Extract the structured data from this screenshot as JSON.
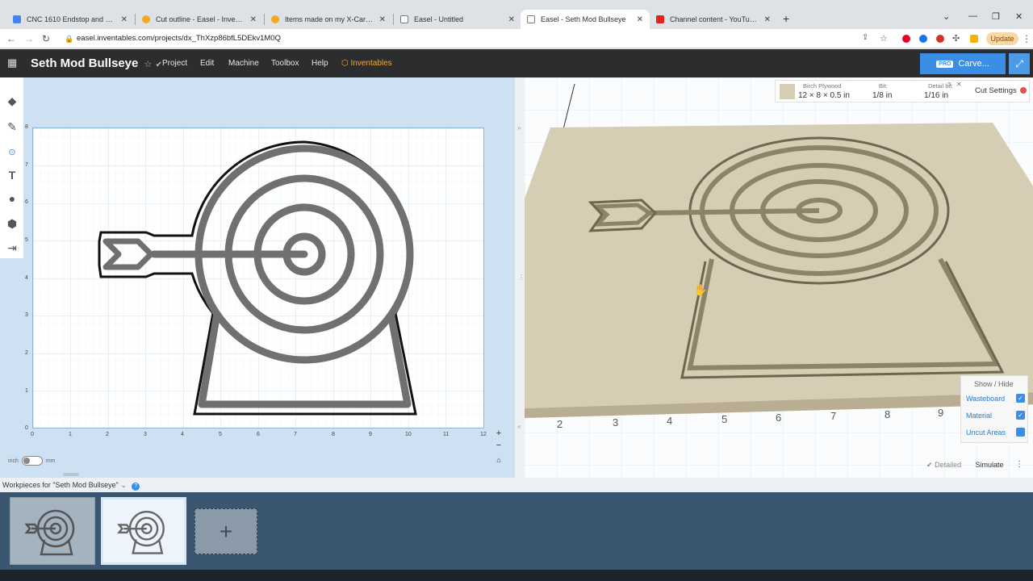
{
  "browser": {
    "tabs": [
      {
        "title": "CNC 1610 Endstop and Chain Fix",
        "favicon_color": "#4285f4"
      },
      {
        "title": "Cut outline - Easel - Inventables",
        "favicon_color": "#f5a623"
      },
      {
        "title": "Items made on my X-Carve Pro -",
        "favicon_color": "#f5a623"
      },
      {
        "title": "Easel - Untitled",
        "favicon_color": "#7a7a7a"
      },
      {
        "title": "Easel - Seth Mod Bullseye",
        "favicon_color": "#7a7a7a"
      },
      {
        "title": "Channel content - YouTube Studio",
        "favicon_color": "#e62117"
      }
    ],
    "active_tab": 4,
    "url": "easel.inventables.com/projects/dx_ThXzp86bfL5DEkv1M0Q",
    "update_label": "Update"
  },
  "app": {
    "project_title": "Seth Mod Bullseye",
    "menu": [
      "Project",
      "Edit",
      "Machine",
      "Toolbox",
      "Help"
    ],
    "inventables_label": "Inventables",
    "carve": {
      "badge": "PRO",
      "label": "Carve..."
    }
  },
  "design": {
    "y_ticks": [
      "8",
      "7",
      "6",
      "5",
      "4",
      "3",
      "2",
      "1",
      "0"
    ],
    "x_ticks": [
      "0",
      "1",
      "2",
      "3",
      "4",
      "5",
      "6",
      "7",
      "8",
      "9",
      "10",
      "11",
      "12"
    ],
    "unit_left": "inch",
    "unit_right": "mm"
  },
  "preview": {
    "material_label": "Birch Plywood",
    "material_value": "12 × 8 × 0.5 in",
    "bit_label": "Bit:",
    "bit_value": "1/8 in",
    "detail_bit_label": "Detail bit:",
    "detail_bit_value": "1/16 in",
    "cut_settings": "Cut Settings",
    "x_ticks": [
      "2",
      "3",
      "4",
      "5",
      "6",
      "7",
      "8",
      "9"
    ],
    "show_hide": {
      "title": "Show / Hide",
      "items": [
        {
          "label": "Wasteboard",
          "checked": true
        },
        {
          "label": "Material",
          "checked": true
        },
        {
          "label": "Uncut Areas",
          "checked": false
        }
      ]
    },
    "detailed_label": "Detailed",
    "simulate_label": "Simulate"
  },
  "workpieces": {
    "label": "Workpieces for \"Seth Mod Bullseye\""
  },
  "colors": {
    "accent": "#3a8ee6",
    "app_header": "#2b2d2f",
    "design_bg": "#cde1f3",
    "tray_bg": "#3b5671",
    "wood": "#d6cdb5"
  }
}
